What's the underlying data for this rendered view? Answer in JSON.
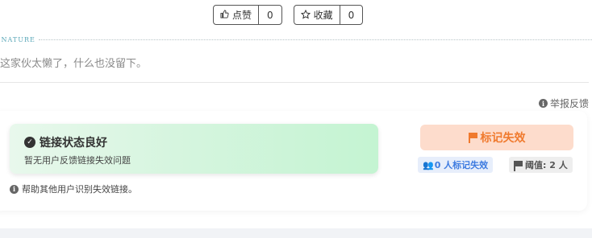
{
  "actions": {
    "like": {
      "label": "点赞",
      "count": "0",
      "icon": "thumbs-up-icon"
    },
    "favorite": {
      "label": "收藏",
      "count": "0",
      "icon": "star-icon"
    }
  },
  "signature": {
    "label": "IGNATURE",
    "text": "这家伙太懒了，什么也没留下。"
  },
  "report": {
    "label": "举报反馈",
    "icon": "info-icon"
  },
  "link_status": {
    "title": "链接状态良好",
    "description": "暂无用户反馈链接失效问题",
    "help": "帮助其他用户识别失效链接。"
  },
  "mark_invalid": {
    "button_label": "标记失效",
    "count_label": "0 人标记失效",
    "threshold_label": "阈值: 2 人"
  },
  "colors": {
    "accent_orange": "#f07a2e",
    "accent_orange_bg": "#fddccc",
    "accent_blue": "#3d7be0",
    "success_bg": "#c4f4d2",
    "signature_label": "#5aa7b8"
  }
}
